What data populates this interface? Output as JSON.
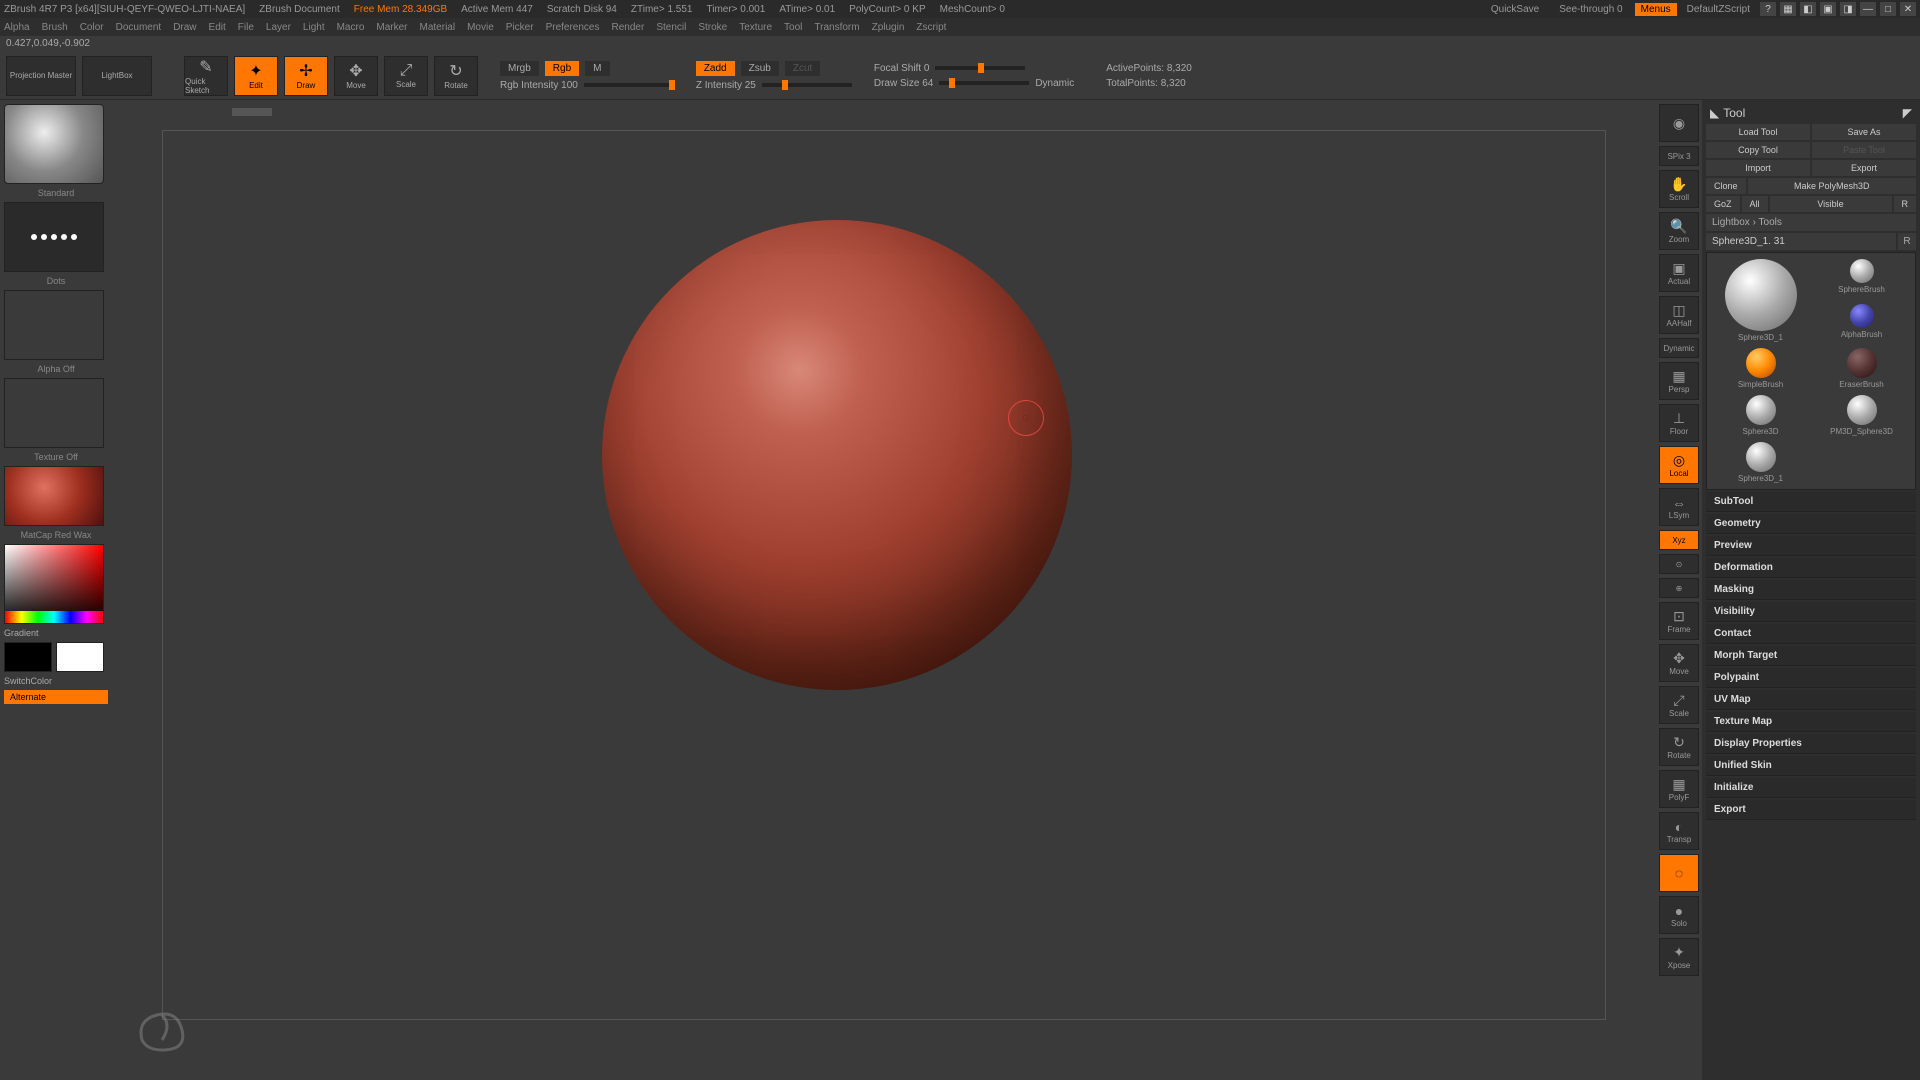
{
  "title_bar": {
    "app": "ZBrush 4R7 P3 [x64][SIUH-QEYF-QWEO-LJTI-NAEA]",
    "doc": "ZBrush Document",
    "free_mem": "Free Mem 28.349GB",
    "active_mem": "Active Mem 447",
    "scratch": "Scratch Disk 94",
    "ztime": "ZTime> 1.551",
    "timer": "Timer> 0.001",
    "atime": "ATime> 0.01",
    "polycount": "PolyCount> 0 KP",
    "meshcount": "MeshCount> 0",
    "quicksave": "QuickSave",
    "seethrough": "See-through  0",
    "menus": "Menus",
    "script": "DefaultZScript"
  },
  "menus": [
    "Alpha",
    "Brush",
    "Color",
    "Document",
    "Draw",
    "Edit",
    "File",
    "Layer",
    "Light",
    "Macro",
    "Marker",
    "Material",
    "Movie",
    "Picker",
    "Preferences",
    "Render",
    "Stencil",
    "Stroke",
    "Texture",
    "Tool",
    "Transform",
    "Zplugin",
    "Zscript"
  ],
  "status": "0.427,0.049,-0.902",
  "toolbar": {
    "projection": "Projection\nMaster",
    "lightbox": "LightBox",
    "quicksketch": "Quick\nSketch",
    "edit": "Edit",
    "draw": "Draw",
    "move": "Move",
    "scale": "Scale",
    "rotate": "Rotate",
    "mrgb": "Mrgb",
    "rgb": "Rgb",
    "m_label": "M",
    "rgb_intensity": "Rgb Intensity 100",
    "zadd": "Zadd",
    "zsub": "Zsub",
    "zcut": "Zcut",
    "z_intensity": "Z Intensity 25",
    "focal_shift": "Focal Shift 0",
    "draw_size": "Draw Size 64",
    "dynamic": "Dynamic",
    "active_points": "ActivePoints: 8,320",
    "total_points": "TotalPoints: 8,320"
  },
  "left": {
    "brush_name": "Standard",
    "stroke_name": "Dots",
    "alpha_off": "Alpha Off",
    "texture_off": "Texture Off",
    "material": "MatCap Red Wax",
    "gradient": "Gradient",
    "switchcolor": "SwitchColor",
    "alternate": "Alternate"
  },
  "right_icons": {
    "spix": "SPix 3",
    "scroll": "Scroll",
    "zoom": "Zoom",
    "actual": "Actual",
    "aahalf": "AAHalf",
    "dynamic": "Dynamic",
    "persp": "Persp",
    "floor": "Floor",
    "local": "Local",
    "lsym": "LSym",
    "xyz": "Xyz",
    "frame": "Frame",
    "move": "Move",
    "scale": "Scale",
    "rotate": "Rotate",
    "polyf": "PolyF",
    "transp": "Transp",
    "solo": "Solo",
    "xpose": "Xpose"
  },
  "tool_panel": {
    "title": "Tool",
    "load": "Load Tool",
    "save": "Save As",
    "copy": "Copy Tool",
    "paste": "Paste Tool",
    "import": "Import",
    "export_btn": "Export",
    "clone": "Clone",
    "make_poly": "Make PolyMesh3D",
    "goz": "GoZ",
    "all": "All",
    "visible": "Visible",
    "r": "R",
    "lightbox_tools": "Lightbox › Tools",
    "tool_name": "Sphere3D_1. 31",
    "items": {
      "sphere3d_1": "Sphere3D_1",
      "spherebrush": "SphereBrush",
      "alphabrush": "AlphaBrush",
      "simplebrush": "SimpleBrush",
      "eraserbrush": "EraserBrush",
      "sphere3d": "Sphere3D",
      "pm3d": "PM3D_Sphere3D",
      "sphere3d_1b": "Sphere3D_1"
    },
    "sections": [
      "SubTool",
      "Geometry",
      "Preview",
      "Deformation",
      "Masking",
      "Visibility",
      "Contact",
      "Morph Target",
      "Polypaint",
      "UV Map",
      "Texture Map",
      "Display Properties",
      "Unified Skin",
      "Initialize",
      "Export"
    ]
  }
}
